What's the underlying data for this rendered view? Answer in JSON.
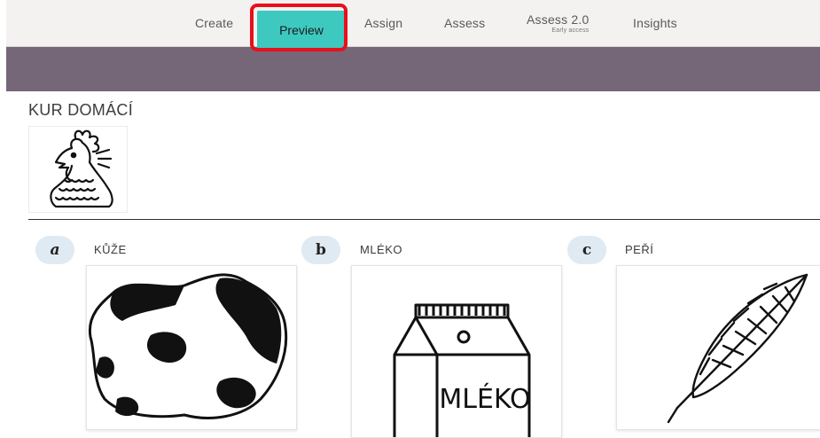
{
  "nav": {
    "items": [
      {
        "label": "Create"
      },
      {
        "label": "Preview",
        "active": true
      },
      {
        "label": "Assign"
      },
      {
        "label": "Assess"
      },
      {
        "label": "Assess 2.0",
        "sublabel": "Early access"
      },
      {
        "label": "Insights"
      }
    ]
  },
  "colors": {
    "active_tab": "#3ec9c0",
    "highlight": "#e8101a",
    "banner": "#756778",
    "badge": "#e0eaf2"
  },
  "question": {
    "title": "KUR DOMÁCÍ",
    "image_icon": "rooster-icon"
  },
  "options": [
    {
      "letter": "a",
      "label": "KŮŽE",
      "image_icon": "cow-hide-icon"
    },
    {
      "letter": "b",
      "label": "MLÉKO",
      "image_icon": "milk-carton-icon",
      "image_text": "MLÉKO"
    },
    {
      "letter": "c",
      "label": "PEŘÍ",
      "image_icon": "feather-icon"
    }
  ]
}
